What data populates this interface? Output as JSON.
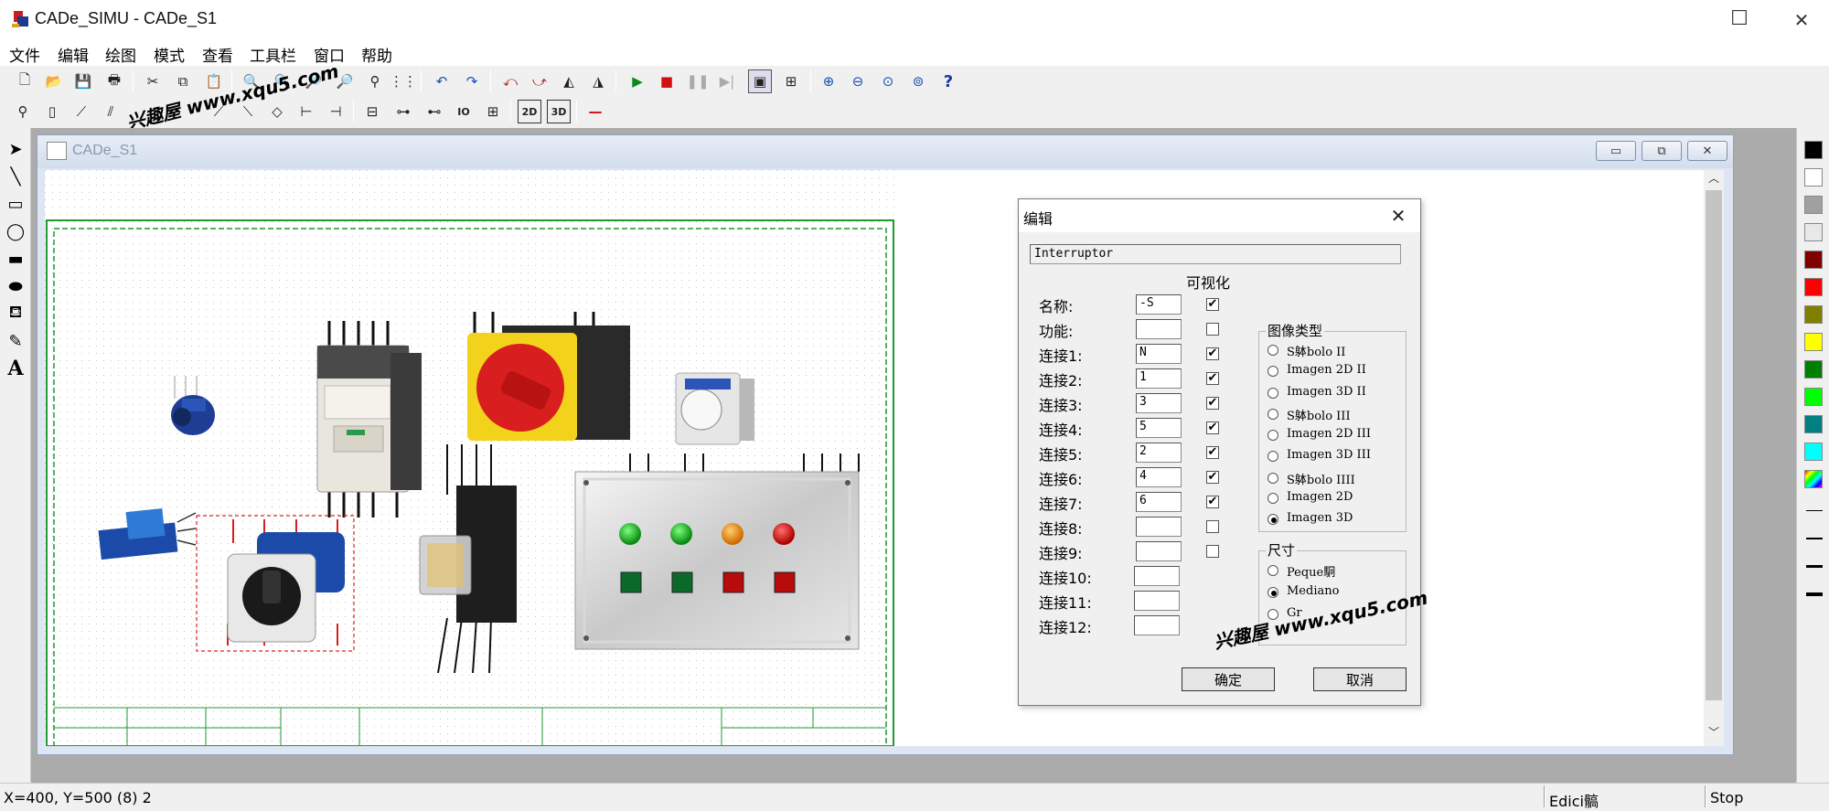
{
  "window": {
    "title": "CADe_SIMU - CADe_S1",
    "minimize": "—",
    "maximize": "☐",
    "close": "✕"
  },
  "menu": [
    "文件",
    "编辑",
    "绘图",
    "模式",
    "查看",
    "工具栏",
    "窗口",
    "帮助"
  ],
  "child_window": {
    "title": "CADe_S1"
  },
  "dialog": {
    "title": "编辑",
    "type_value": "Interruptor",
    "visible_header": "可视化",
    "rows": [
      {
        "label": "名称:",
        "value": "-S",
        "checked": true
      },
      {
        "label": "功能:",
        "value": "",
        "checked": false
      },
      {
        "label": "连接1:",
        "value": "N",
        "checked": true
      },
      {
        "label": "连接2:",
        "value": "1",
        "checked": true
      },
      {
        "label": "连接3:",
        "value": "3",
        "checked": true
      },
      {
        "label": "连接4:",
        "value": "5",
        "checked": true
      },
      {
        "label": "连接5:",
        "value": "2",
        "checked": true
      },
      {
        "label": "连接6:",
        "value": "4",
        "checked": true
      },
      {
        "label": "连接7:",
        "value": "6",
        "checked": true
      },
      {
        "label": "连接8:",
        "value": "",
        "checked": false
      },
      {
        "label": "连接9:",
        "value": "",
        "checked": false
      },
      {
        "label": "连接10:",
        "value": "",
        "checked": null
      },
      {
        "label": "连接11:",
        "value": "",
        "checked": null
      },
      {
        "label": "连接12:",
        "value": "",
        "checked": null
      }
    ],
    "image_type_label": "图像类型",
    "image_types": [
      "S躰bolo II",
      "Imagen 2D II",
      "Imagen 3D II",
      "S躰bolo III",
      "Imagen 2D III",
      "Imagen 3D III",
      "S躰bolo IIII",
      "Imagen 2D",
      "Imagen 3D"
    ],
    "image_type_selected": "Imagen 3D",
    "size_label": "尺寸",
    "sizes": [
      "Peque駉",
      "Mediano",
      "Gr"
    ],
    "size_selected": "Mediano",
    "ok_label": "确定",
    "cancel_label": "取消"
  },
  "status": {
    "coords": "X=400, Y=500 (8) 2",
    "mode": "Edici髇",
    "state": "Stop"
  },
  "watermarks": [
    "兴趣屋 www.xqu5.com",
    "兴趣屋 www.xqu5.com"
  ],
  "palette_colors": [
    "#000000",
    "#ffffff",
    "#a0a0a0",
    "#e8e8e8",
    "#800000",
    "#ff0000",
    "#808000",
    "#ffff00",
    "#008000",
    "#00ff00",
    "#008080",
    "#00ffff"
  ],
  "colors": {
    "frame_green": "#1f9a2f",
    "background_gray": "#ababab"
  }
}
